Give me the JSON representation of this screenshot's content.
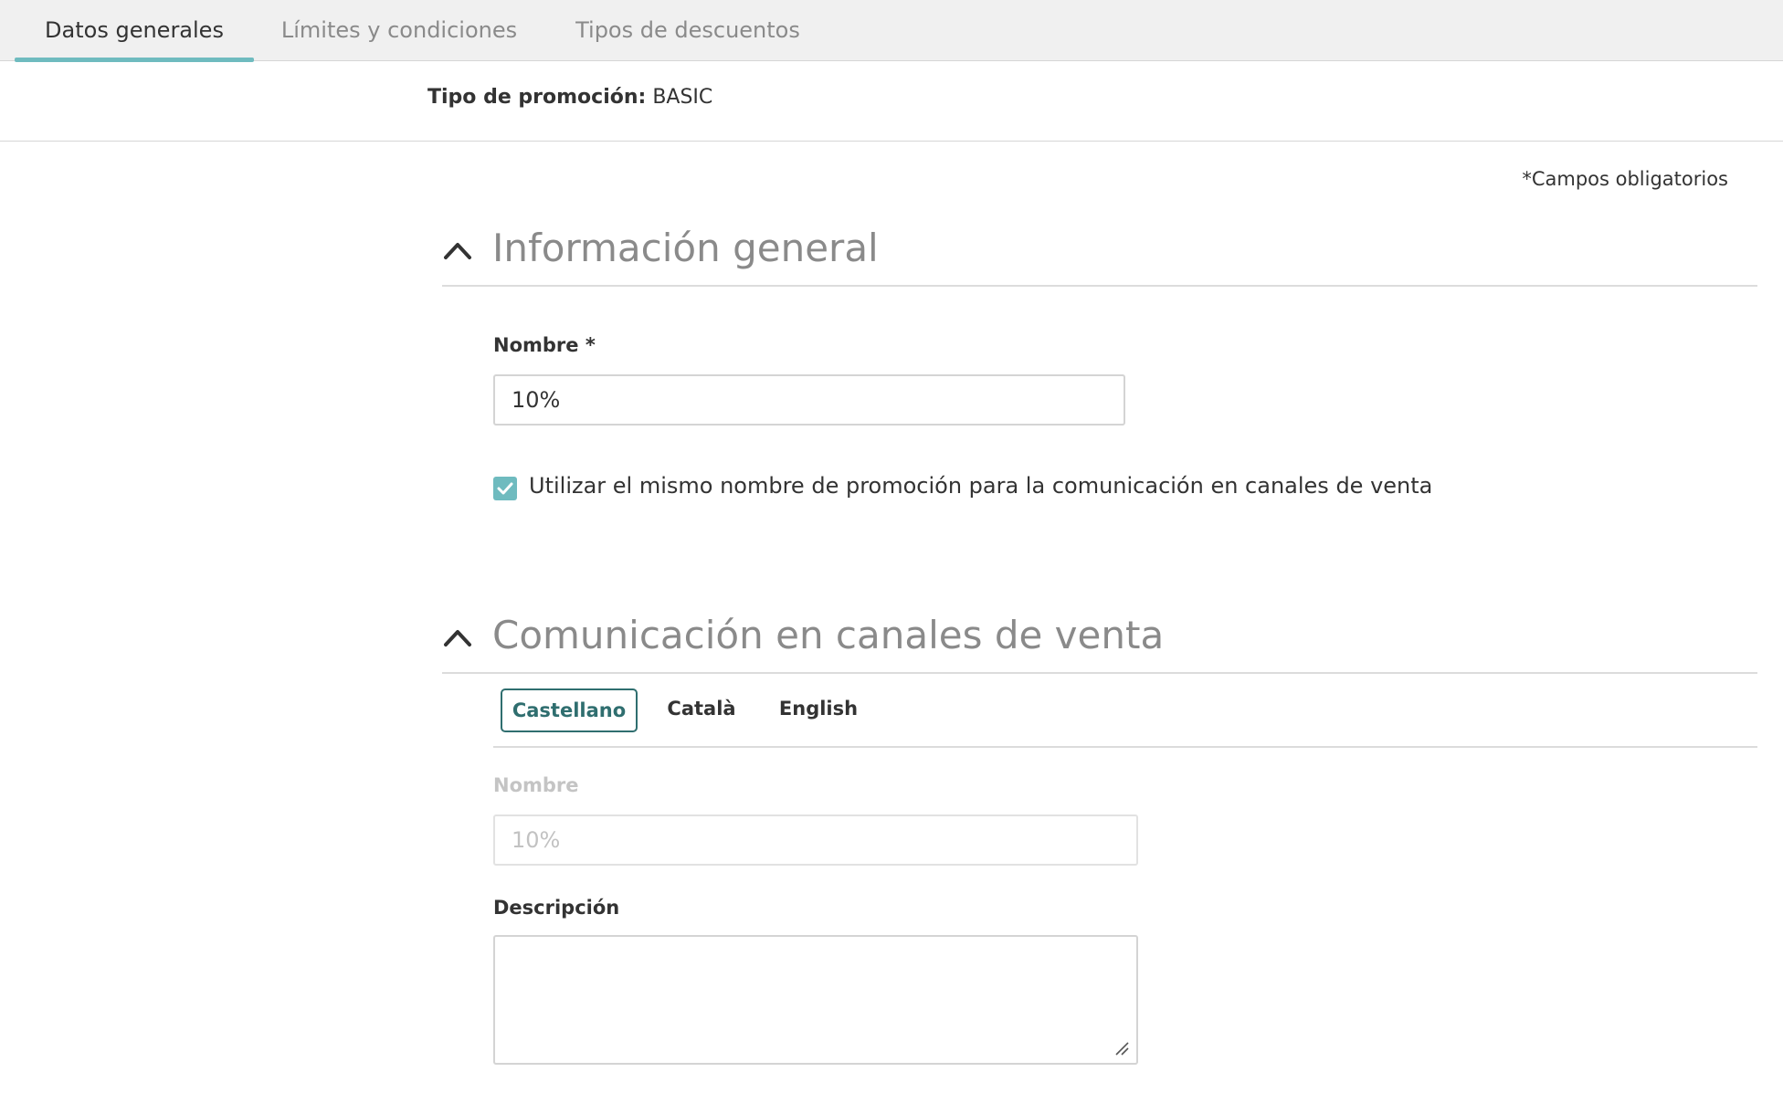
{
  "tabs": [
    {
      "label": "Datos generales",
      "active": true
    },
    {
      "label": "Límites y condiciones",
      "active": false
    },
    {
      "label": "Tipos de descuentos",
      "active": false
    }
  ],
  "promo_type": {
    "label": "Tipo de promoción:",
    "value": "BASIC"
  },
  "required_note": "*Campos obligatorios",
  "general_section": {
    "title": "Información general",
    "name_label": "Nombre *",
    "name_value": "10%",
    "same_name_checkbox": {
      "checked": true,
      "label": "Utilizar el mismo nombre de promoción para la comunicación en canales de venta"
    }
  },
  "channels_section": {
    "title": "Comunicación en canales de venta",
    "languages": [
      {
        "label": "Castellano",
        "active": true
      },
      {
        "label": "Català",
        "active": false
      },
      {
        "label": "English",
        "active": false
      }
    ],
    "name_label": "Nombre",
    "name_value": "10%",
    "description_label": "Descripción",
    "description_value": ""
  },
  "colors": {
    "accent": "#6fbbbf",
    "active_lang": "#2f6e6f"
  }
}
